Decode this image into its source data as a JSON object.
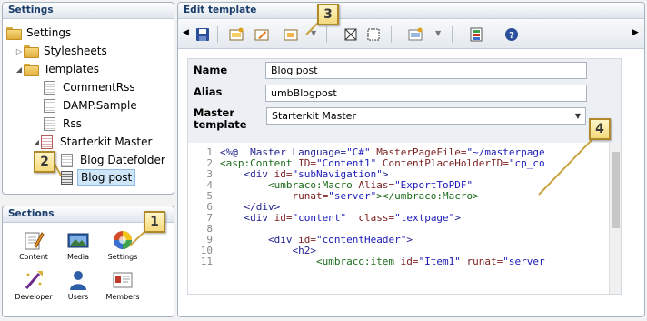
{
  "settings": {
    "header": "Settings",
    "root": "Settings",
    "items": [
      "Stylesheets",
      "Templates",
      "CommentRss",
      "DAMP.Sample",
      "Rss",
      "Starterkit Master",
      "Blog Datefolder",
      "Blog post"
    ]
  },
  "sections": {
    "header": "Sections",
    "items": [
      "Content",
      "Media",
      "Settings",
      "Developer",
      "Users",
      "Members"
    ]
  },
  "edit": {
    "header": "Edit template",
    "name_label": "Name",
    "name_value": "Blog post",
    "alias_label": "Alias",
    "alias_value": "umbBlogpost",
    "master_label_1": "Master",
    "master_label_2": "template",
    "master_value": "Starterkit Master",
    "line_numbers": [
      "1",
      "2",
      "3",
      "4",
      "5",
      "6",
      "7",
      "8",
      "9",
      "10",
      "11"
    ]
  },
  "code": {
    "l1a": "<%@  Master Language=",
    "l1b": "\"C#\"",
    "l1c": " MasterPageFile=",
    "l1d": "\"~/masterpage",
    "l2a": "<asp:Content",
    "l2b": " ID=",
    "l2c": "\"Content1\"",
    "l2d": " ContentPlaceHolderID=",
    "l2e": "\"cp_co",
    "l3a": "    <div",
    "l3b": " id=",
    "l3c": "\"subNavigation\"",
    "l3d": ">",
    "l4a": "        <umbraco:Macro",
    "l4b": " Alias=",
    "l4c": "\"ExportToPDF\"",
    "l5a": "            runat=",
    "l5b": "\"server\"",
    "l5c": "></umbraco:Macro>",
    "l6": "    </div>",
    "l7a": "    <div",
    "l7b": " id=",
    "l7c": "\"content\"",
    "l7d": "  class=",
    "l7e": "\"textpage\"",
    "l7f": ">",
    "l8": "",
    "l9a": "        <div",
    "l9b": " id=",
    "l9c": "\"contentHeader\"",
    "l9d": ">",
    "l10": "            <h2>",
    "l11a": "                <umbraco:item",
    "l11b": " id=",
    "l11c": "\"Item1\"",
    "l11d": " runat=",
    "l11e": "\"server"
  },
  "callouts": [
    "1",
    "2",
    "3",
    "4"
  ],
  "colors": {
    "panel_header_text": "#1a3d6b",
    "callout_bg": "#f4d97c",
    "callout_border": "#b08a2a",
    "callout_line": "#c9a441",
    "selected_bg": "#cfe6f9"
  },
  "icons": [
    "folder-icon",
    "template-icon",
    "save-icon",
    "insert-field-icon",
    "insert-macro-icon",
    "insert-content-area-icon",
    "help-icon"
  ]
}
